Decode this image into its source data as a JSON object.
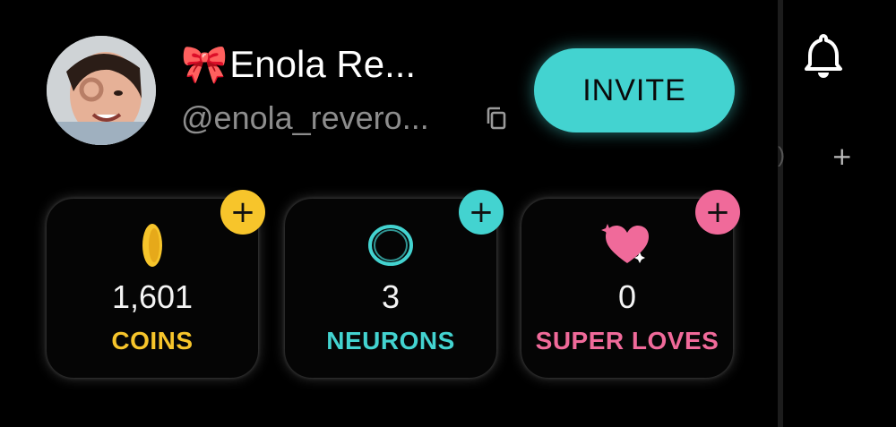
{
  "profile": {
    "name_emoji": "🎀",
    "name": "Enola Re...",
    "handle": "@enola_revero...",
    "avatar_icon": "profile-photo"
  },
  "actions": {
    "invite_label": "INVITE",
    "copy_icon": "copy-icon"
  },
  "stats": [
    {
      "key": "coins",
      "value": "1,601",
      "label": "COINS",
      "color": "#f7c52b",
      "badge_color": "#f7c52b",
      "icon": "coin-icon"
    },
    {
      "key": "neurons",
      "value": "3",
      "label": "NEURONS",
      "color": "#43d3d0",
      "badge_color": "#43d3d0",
      "icon": "neuron-ring-icon"
    },
    {
      "key": "super_loves",
      "value": "0",
      "label": "SUPER LOVES",
      "color": "#f06a9a",
      "badge_color": "#f06a9a",
      "icon": "sparkle-heart-icon"
    }
  ],
  "badge_symbol": "+",
  "side": {
    "bell_icon": "bell-icon",
    "plus_label": "+",
    "paren": ")"
  },
  "colors": {
    "background": "#000000",
    "accent": "#43d3d0",
    "muted_text": "#8d8d8d"
  }
}
